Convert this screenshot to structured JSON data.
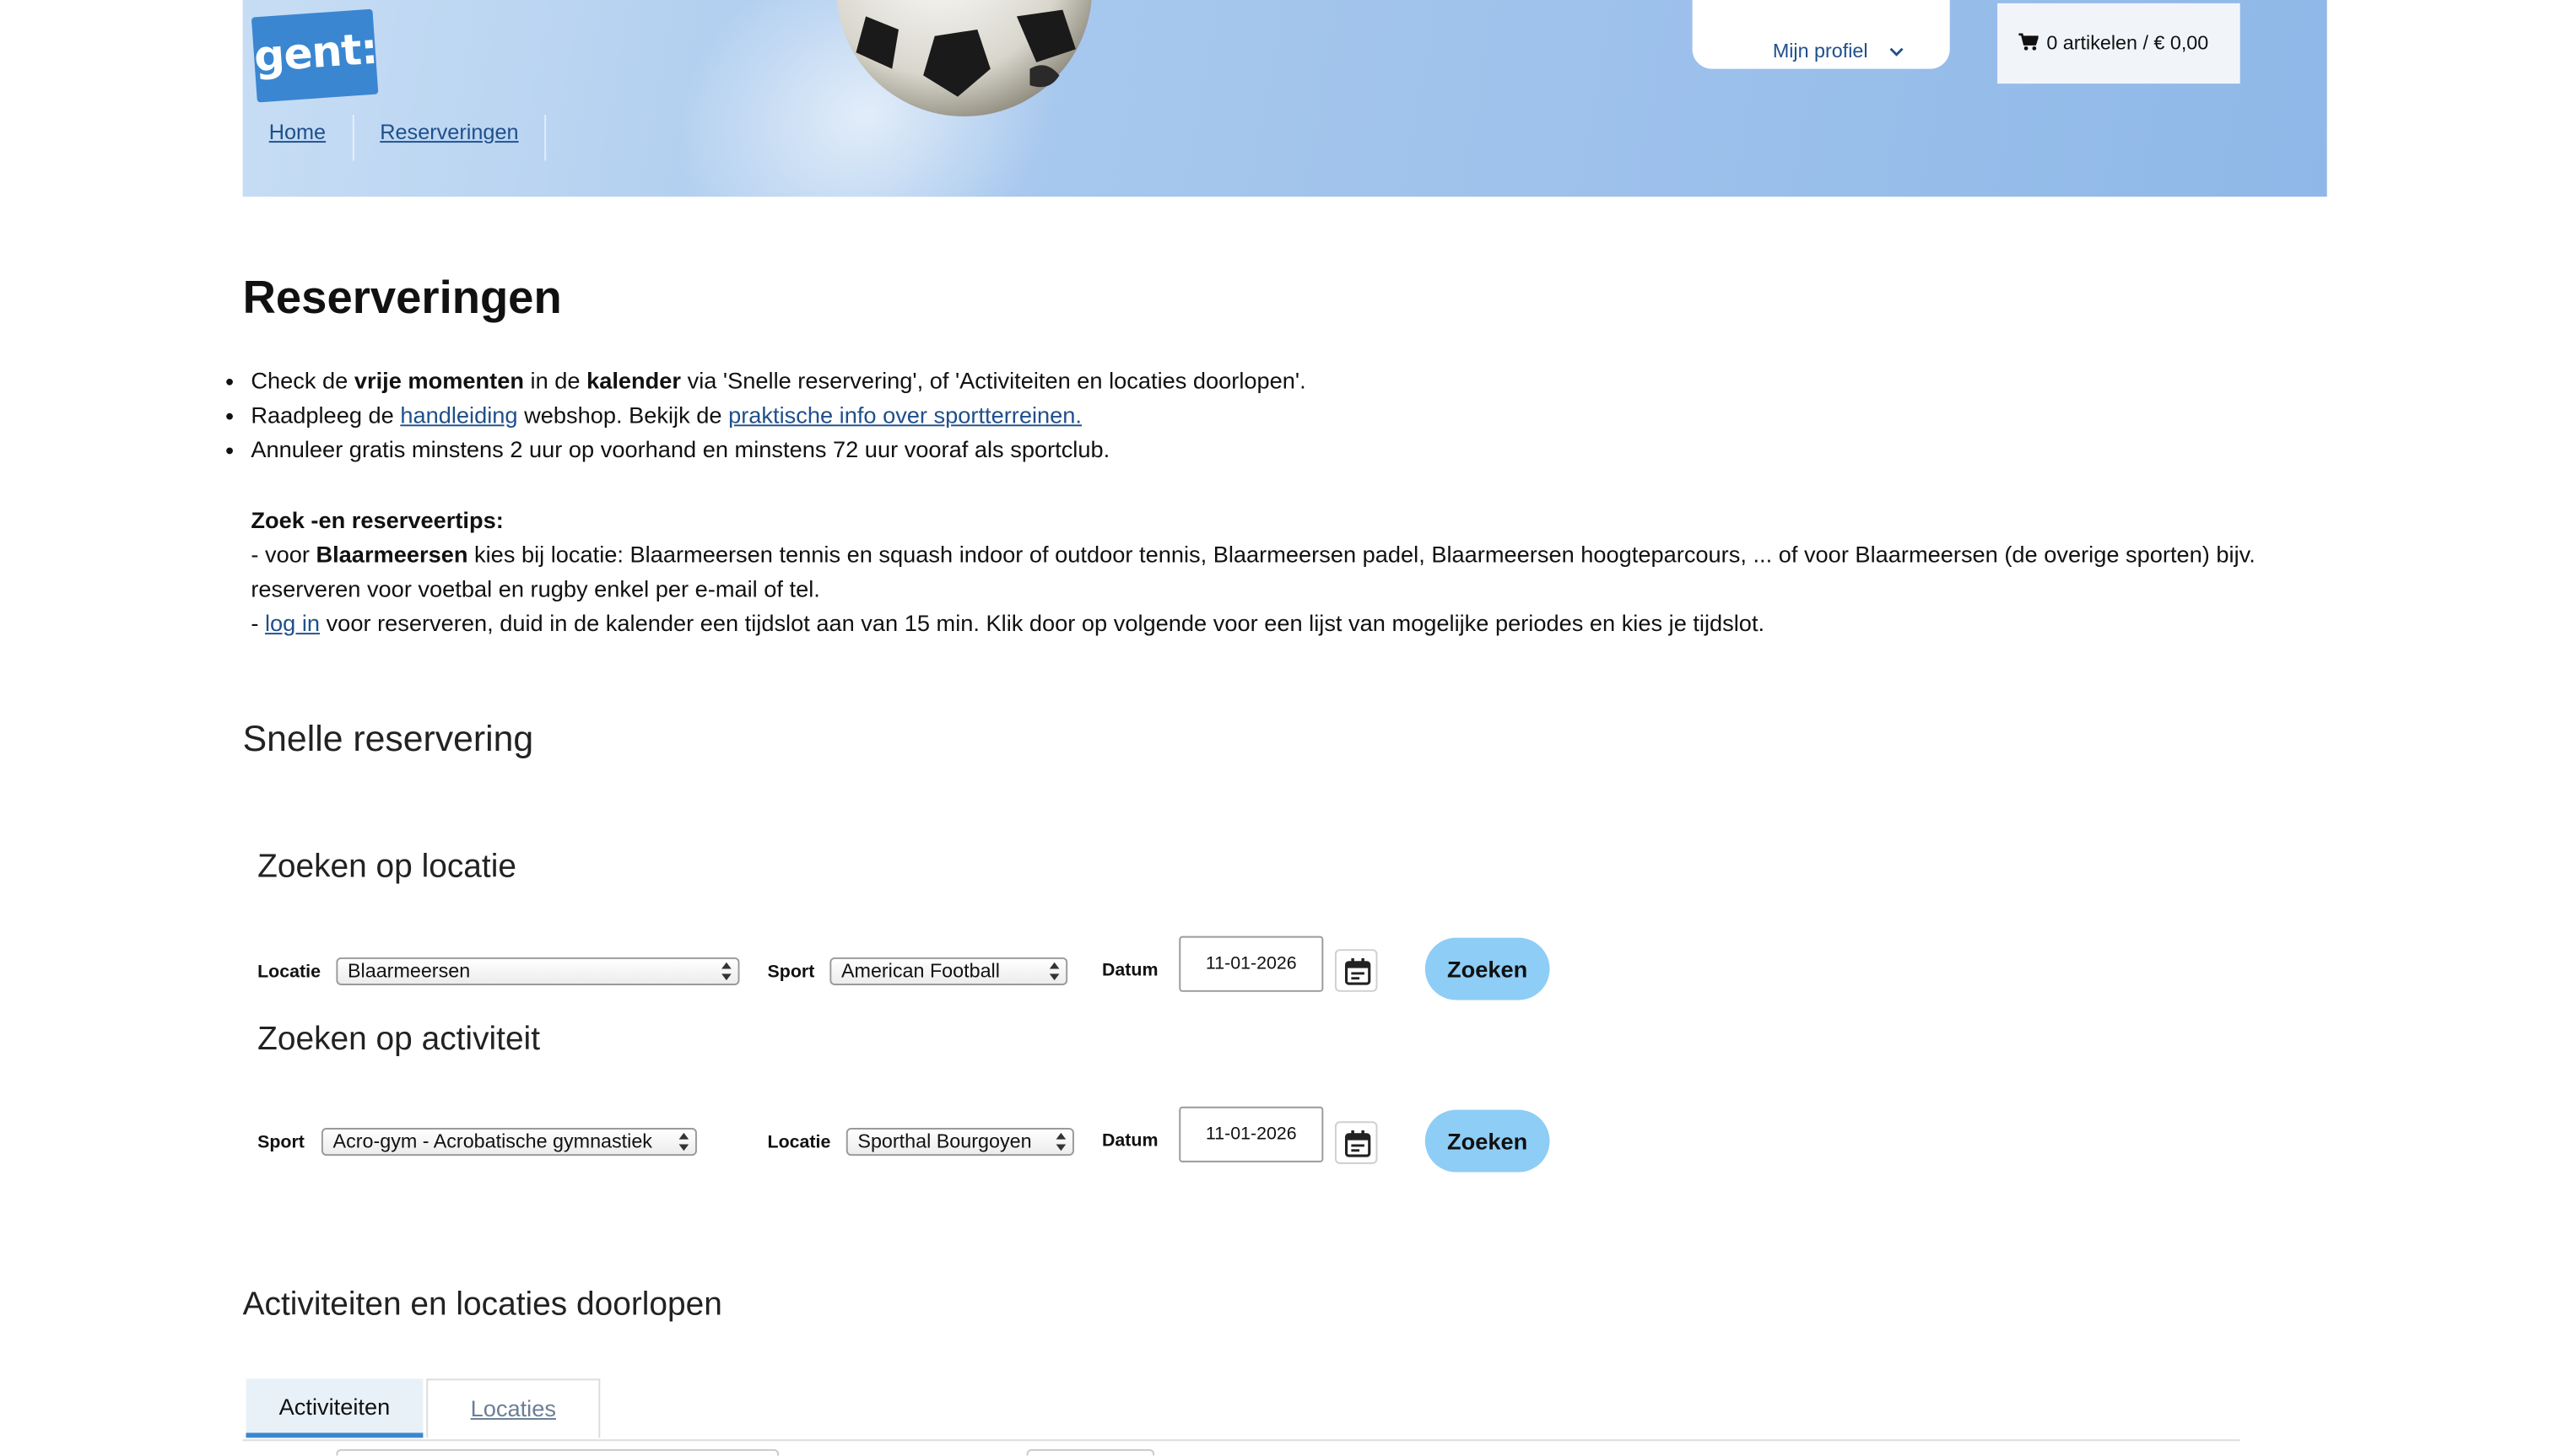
{
  "header": {
    "logo_text": "gent:",
    "breadcrumb": [
      "Home",
      "Reserveringen"
    ],
    "profile_label": "Mijn profiel",
    "cart_label": "0 artikelen / € 0,00"
  },
  "page": {
    "title": "Reserveringen",
    "bullets": [
      {
        "t1": "Check de ",
        "b1": "vrije momenten",
        "t2": " in de ",
        "b2": "kalender",
        "t3": " via 'Snelle reservering', of 'Activiteiten en locaties doorlopen'."
      },
      {
        "t1": "Raadpleeg de ",
        "link1": "handleiding",
        "t2": " webshop. Bekijk de ",
        "link2": "praktische info over sportterreinen."
      },
      {
        "t1": "Annuleer gratis minstens 2 uur op voorhand en minstens 72 uur vooraf als sportclub."
      }
    ],
    "tips": {
      "heading": "Zoek -en reserveertips:",
      "line1_a": "- voor ",
      "line1_b": "Blaarmeersen",
      "line1_c": " kies bij locatie: Blaarmeersen tennis en squash indoor of outdoor tennis, Blaarmeersen padel, Blaarmeersen hoogteparcours, ... of voor Blaarmeersen (de overige sporten) bijv. reserveren voor voetbal en rugby enkel per e-mail of tel.",
      "line2_a": "- ",
      "line2_link": "log in",
      "line2_b": " voor reserveren, duid in de kalender een tijdslot aan van 15 min. Klik door op volgende voor een lijst van mogelijke periodes en kies je tijdslot."
    }
  },
  "quick": {
    "title": "Snelle reservering",
    "by_location": {
      "title": "Zoeken op locatie",
      "location_label": "Locatie",
      "location_value": "Blaarmeersen",
      "sport_label": "Sport",
      "sport_value": "American Football",
      "date_label": "Datum",
      "date_value": "11-01-2026",
      "button": "Zoeken"
    },
    "by_activity": {
      "title": "Zoeken op activiteit",
      "sport_label": "Sport",
      "sport_value": "Acro-gym - Acrobatische gymnastiek",
      "location_label": "Locatie",
      "location_value": "Sporthal Bourgoyen",
      "date_label": "Datum",
      "date_value": "11-01-2026",
      "button": "Zoeken"
    }
  },
  "browse": {
    "title": "Activiteiten en locaties doorlopen",
    "tabs": [
      "Activiteiten",
      "Locaties"
    ]
  },
  "icons": {
    "ball": "soccer-ball-image",
    "cart": "cart-icon",
    "profile_chevron": "chevron-down-icon",
    "calendar": "calendar-icon",
    "select_arrows": "select-arrows-icon"
  },
  "colors": {
    "link": "#1f4f8c",
    "button": "#8ecdf5",
    "logo": "#3a86d1",
    "tab_active_border": "#3a86d1"
  }
}
